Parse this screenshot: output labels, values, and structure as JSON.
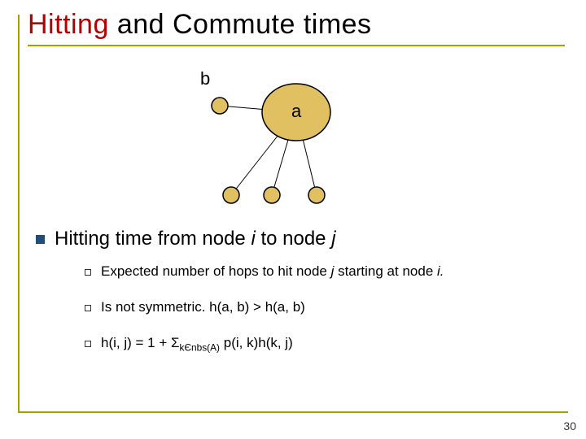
{
  "title": {
    "accent": "Hitting",
    "rest": " and Commute times"
  },
  "diagram": {
    "node_b": "b",
    "node_a": "a"
  },
  "main_bullet": {
    "pre": "Hitting time from node ",
    "i": "i",
    "mid": " to node ",
    "j": "j"
  },
  "subs": {
    "s1_pre": "Expected number of hops to hit node ",
    "s1_j": "j",
    "s1_mid": " starting at node ",
    "s1_i": "i.",
    "s2": "Is not symmetric. h(a, b) > h(a, b)",
    "s3_pre": "h(i, j) = 1 + Σ",
    "s3_sub": "kЄnbs(A)",
    "s3_post": " p(i, k)h(k, j)"
  },
  "page_number": "30"
}
